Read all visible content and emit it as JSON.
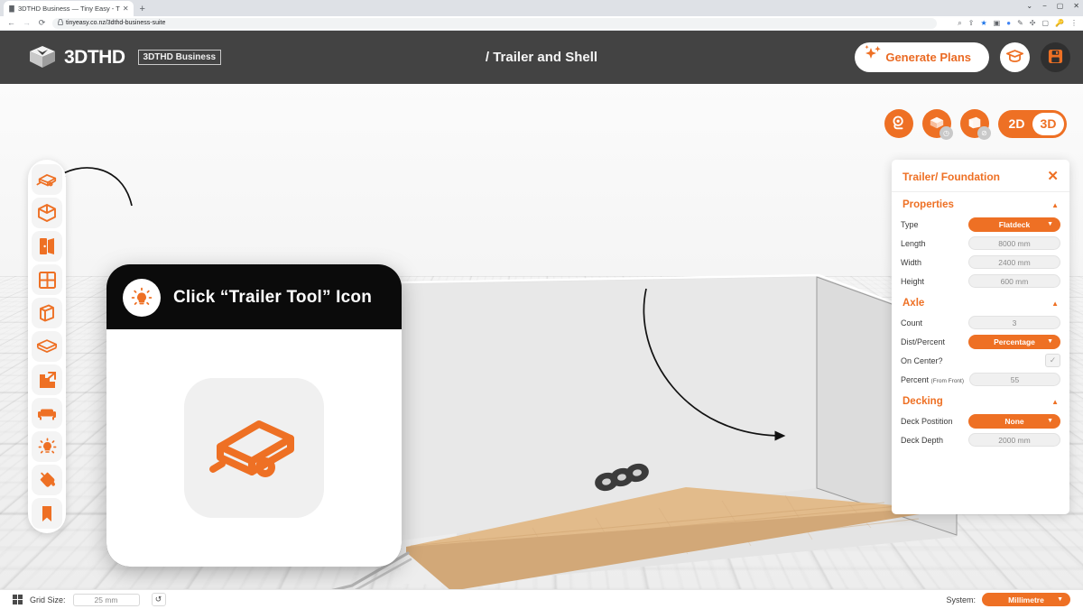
{
  "browser": {
    "tab_title": "3DTHD Business — Tiny Easy - T",
    "tab_close": "✕",
    "new_tab": "+",
    "url": "tinyeasy.co.nz/3dthd-business-suite",
    "back": "←",
    "forward": "→",
    "reload": "⟳",
    "lock": "🔒",
    "win_minimize": "−",
    "win_maximize": "▢",
    "win_close": "✕",
    "win_chevron": "⌄",
    "toolbar_icons": [
      "zoom-icon",
      "share-icon",
      "bookmark-star-icon",
      "camera-icon",
      "profile-globe-icon",
      "pen-icon",
      "extensions-icon",
      "sidepanel-icon",
      "password-icon",
      "menu-icon"
    ]
  },
  "header": {
    "logo_text": "3DTHD",
    "logo_badge": "3DTHD Business",
    "title": "/ Trailer and Shell",
    "generate_plans": "Generate Plans",
    "learn_button": "learn-graduation-cap",
    "save_button": "save-disk"
  },
  "view_controls": {
    "orbit": "orbit-camera-icon",
    "shell_visibility": "shell-visibility-icon",
    "roof_visibility": "roof-visibility-icon",
    "dim_2d": "2D",
    "dim_3d": "3D",
    "dim_active": "3D"
  },
  "toolbar": {
    "items": [
      {
        "name": "trailer-tool",
        "label": "Trailer"
      },
      {
        "name": "shell-tool",
        "label": "Shell"
      },
      {
        "name": "door-tool",
        "label": "Door"
      },
      {
        "name": "window-tool",
        "label": "Window"
      },
      {
        "name": "wall-tool",
        "label": "Wall"
      },
      {
        "name": "floor-tool",
        "label": "Floor"
      },
      {
        "name": "stairs-tool",
        "label": "Stairs"
      },
      {
        "name": "furniture-tool",
        "label": "Furniture"
      },
      {
        "name": "lighting-tool",
        "label": "Lighting"
      },
      {
        "name": "paint-tool",
        "label": "Paint"
      },
      {
        "name": "bookmark-tool",
        "label": "Bookmark"
      }
    ]
  },
  "callout": {
    "icon": "lightbulb-icon",
    "text": "Click “Trailer Tool” Icon",
    "big_icon": "trailer-flatdeck-icon"
  },
  "panel": {
    "title": "Trailer/ Foundation",
    "close": "✕",
    "sections": [
      {
        "title": "Properties",
        "caret": "▲",
        "rows": [
          {
            "label": "Type",
            "value": "Flatdeck",
            "kind": "select"
          },
          {
            "label": "Length",
            "value": "8000 mm",
            "kind": "text"
          },
          {
            "label": "Width",
            "value": "2400 mm",
            "kind": "text"
          },
          {
            "label": "Height",
            "value": "600 mm",
            "kind": "text"
          }
        ]
      },
      {
        "title": "Axle",
        "caret": "▲",
        "rows": [
          {
            "label": "Count",
            "value": "3",
            "kind": "text"
          },
          {
            "label": "Dist/Percent",
            "value": "Percentage",
            "kind": "select"
          },
          {
            "label": "On Center?",
            "value": "✓",
            "kind": "check"
          },
          {
            "label": "Percent",
            "sub": "(From Front)",
            "value": "55",
            "kind": "text"
          }
        ]
      },
      {
        "title": "Decking",
        "caret": "▲",
        "rows": [
          {
            "label": "Deck Postition",
            "value": "None",
            "kind": "select"
          },
          {
            "label": "Deck Depth",
            "value": "2000 mm",
            "kind": "text"
          }
        ]
      }
    ]
  },
  "status": {
    "grid_icon": "grid-icon",
    "grid_label": "Grid Size:",
    "grid_value": "25 mm",
    "reset": "↺",
    "system_label": "System:",
    "system_value": "Millimetre",
    "caret": "▼"
  },
  "colors": {
    "accent": "#ee7024",
    "header_bg": "#434343",
    "callout_bg": "#0b0b0b",
    "deck_wood": "#e0b989"
  }
}
